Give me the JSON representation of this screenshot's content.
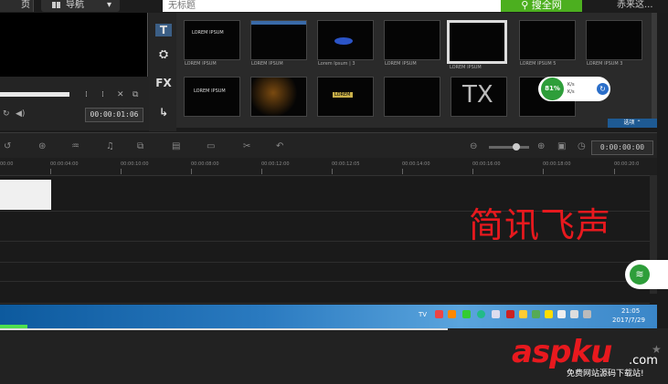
{
  "browser": {
    "home_label": "页",
    "nav_label": "导航",
    "nav_caret": "▾",
    "search_placeholder": "无标题",
    "search_button": "搜全网",
    "search_icon": "search-icon",
    "right_link": "赤来这..."
  },
  "preview": {
    "timecode": "00:00:01:06"
  },
  "library": {
    "tools": [
      "T",
      "FX"
    ],
    "thumbs": [
      {
        "caption": "LOREM IPSUM",
        "inner": "LOREM IPSUM"
      },
      {
        "caption": "LOREM IPSUM",
        "inner": ""
      },
      {
        "caption": "Lorem Ipsum | 3",
        "inner": ""
      },
      {
        "caption": "LOREM IPSUM",
        "inner": ""
      },
      {
        "caption": "LOREM IPSUM",
        "inner": ""
      },
      {
        "caption": "LOREM IPSUM 5",
        "inner": ""
      },
      {
        "caption": "LOREM IPSUM 3",
        "inner": ""
      },
      {
        "caption": "",
        "inner": "LOREM IPSUM"
      },
      {
        "caption": "",
        "inner": ""
      },
      {
        "caption": "",
        "inner": "LOREM"
      },
      {
        "caption": "",
        "inner": ""
      },
      {
        "caption": "",
        "inner": "TX"
      }
    ],
    "footer_label": "选项 ⌃"
  },
  "progress_widget": {
    "percent": "81%",
    "line1": "K/s",
    "line2": "K/s"
  },
  "timeline": {
    "timecode": "0:00:00:00",
    "ruler_labels": [
      "00:00",
      "00:00:04:00",
      "00:00:10:00",
      "00:00:08:00",
      "00:00:12:00",
      "00:00:12:05",
      "00:00:14:00",
      "00:00:16:00",
      "00:00:18:00",
      "00:00:20:0"
    ]
  },
  "overlay_text": "简讯飞声",
  "taskbar": {
    "tray_label": "TV",
    "clock_time": "21:05",
    "clock_date": "2017/7/29"
  },
  "watermark": {
    "logo_main": "aspku",
    "logo_com": ".com",
    "tagline": "免费网站源码下载站!"
  },
  "colors": {
    "search_green": "#4caf1f",
    "overlay_red": "#e8191e",
    "widget_green": "#2e9e3a",
    "taskbar_blue": "#2a7ac0"
  }
}
